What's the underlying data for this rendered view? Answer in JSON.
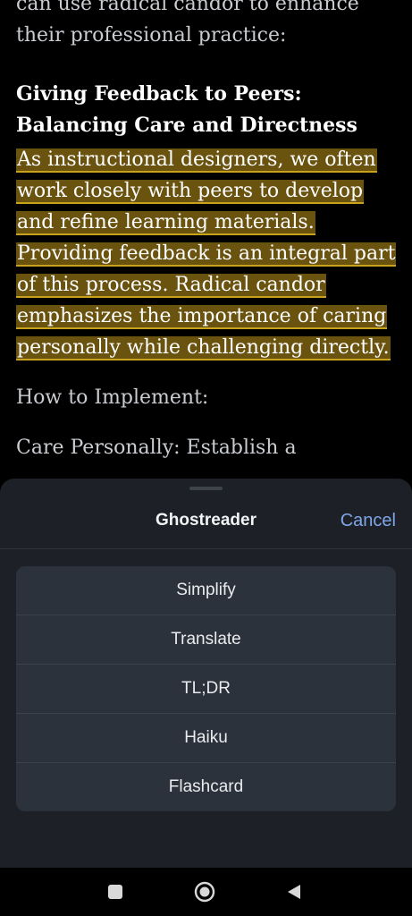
{
  "article": {
    "intro": "can use radical candor to enhance their professional practice:",
    "heading_line1": "Giving Feedback to Peers:",
    "heading_line2": "Balancing Care and Directness",
    "highlighted_paragraph": "As instructional designers, we often work closely with peers to develop and refine learning materials. Providing feedback is an integral part of this process. Radical candor emphasizes the importance of caring personally while challenging directly.",
    "how_to": "How to Implement:",
    "care_personally": "Care Personally: Establish a",
    "highlight_color": "#6a520f",
    "highlight_underline_color": "#c9a21d"
  },
  "sheet": {
    "title": "Ghostreader",
    "cancel_label": "Cancel",
    "options": [
      "Simplify",
      "Translate",
      "TL;DR",
      "Haiku",
      "Flashcard"
    ]
  },
  "navbar": {
    "recents_icon": "square-recents-icon",
    "home_icon": "circle-home-icon",
    "back_icon": "triangle-back-icon"
  }
}
